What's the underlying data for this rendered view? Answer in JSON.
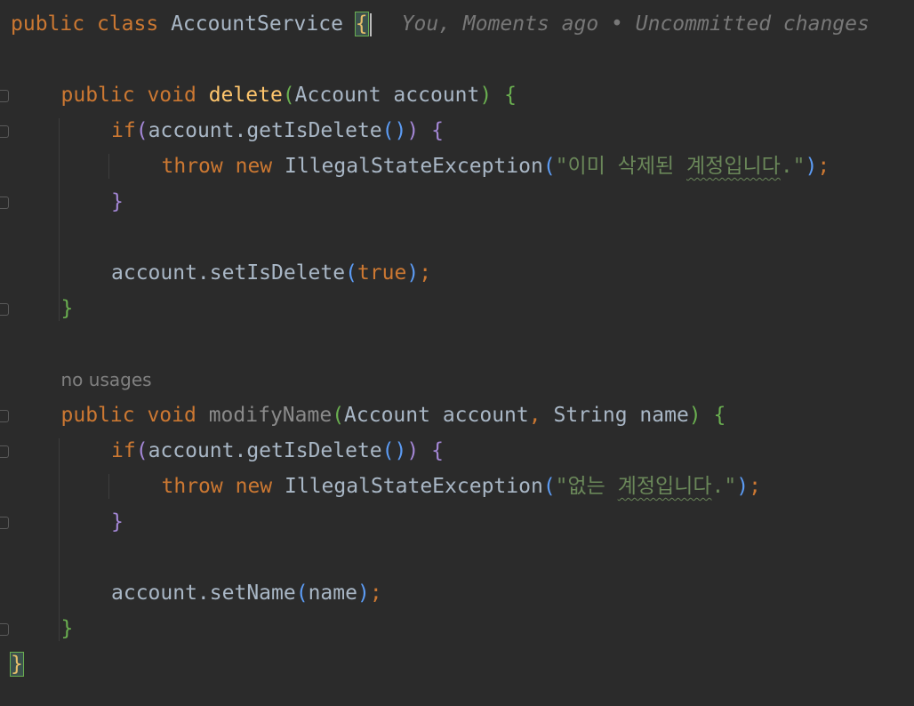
{
  "lines": [
    {
      "tokens": [
        {
          "t": "public",
          "c": "kw"
        },
        {
          "t": " "
        },
        {
          "t": "class",
          "c": "kw"
        },
        {
          "t": " "
        },
        {
          "t": "AccountService",
          "c": "cls"
        },
        {
          "t": " "
        },
        {
          "t": "{",
          "c": "brace-yellow brace-match"
        }
      ],
      "caret": true,
      "blame": "You, Moments ago • Uncommitted changes"
    },
    {
      "tokens": []
    },
    {
      "tokens": [
        {
          "t": "public",
          "c": "kw"
        },
        {
          "t": " "
        },
        {
          "t": "void",
          "c": "kw"
        },
        {
          "t": " "
        },
        {
          "t": "delete",
          "c": "fn"
        },
        {
          "t": "(",
          "c": "paren-green"
        },
        {
          "t": "Account account"
        },
        {
          "t": ")",
          "c": "paren-green"
        },
        {
          "t": " "
        },
        {
          "t": "{",
          "c": "brace-green"
        }
      ]
    },
    {
      "tokens": [
        {
          "t": "if",
          "c": "kw"
        },
        {
          "t": "(",
          "c": "paren-purple"
        },
        {
          "t": "account.getIsDelete"
        },
        {
          "t": "()",
          "c": "paren-blue"
        },
        {
          "t": ")",
          "c": "paren-purple"
        },
        {
          "t": " "
        },
        {
          "t": "{",
          "c": "paren-purple"
        }
      ]
    },
    {
      "tokens": [
        {
          "t": "throw",
          "c": "kw"
        },
        {
          "t": " "
        },
        {
          "t": "new",
          "c": "kw"
        },
        {
          "t": " "
        },
        {
          "t": "IllegalStateException"
        },
        {
          "t": "(",
          "c": "paren-blue"
        },
        {
          "t": "\"이미 삭제된 ",
          "c": "str"
        },
        {
          "t": "계정입니다",
          "c": "str str-typo"
        },
        {
          "t": ".\"",
          "c": "str"
        },
        {
          "t": ")",
          "c": "paren-blue"
        },
        {
          "t": ";",
          "c": "semi"
        }
      ]
    },
    {
      "tokens": [
        {
          "t": "}",
          "c": "paren-purple"
        }
      ]
    },
    {
      "tokens": []
    },
    {
      "tokens": [
        {
          "t": "account.setIsDelete"
        },
        {
          "t": "(",
          "c": "paren-blue"
        },
        {
          "t": "true",
          "c": "kw"
        },
        {
          "t": ")",
          "c": "paren-blue"
        },
        {
          "t": ";",
          "c": "semi"
        }
      ]
    },
    {
      "tokens": [
        {
          "t": "}",
          "c": "brace-green"
        }
      ]
    },
    {
      "tokens": []
    },
    {
      "hint": "no usages"
    },
    {
      "tokens": [
        {
          "t": "public",
          "c": "kw"
        },
        {
          "t": " "
        },
        {
          "t": "void",
          "c": "kw"
        },
        {
          "t": " "
        },
        {
          "t": "modifyName",
          "c": "fn-unused"
        },
        {
          "t": "(",
          "c": "paren-green"
        },
        {
          "t": "Account account"
        },
        {
          "t": ",",
          "c": "comma"
        },
        {
          "t": " String name"
        },
        {
          "t": ")",
          "c": "paren-green"
        },
        {
          "t": " "
        },
        {
          "t": "{",
          "c": "brace-green"
        }
      ]
    },
    {
      "tokens": [
        {
          "t": "if",
          "c": "kw"
        },
        {
          "t": "(",
          "c": "paren-purple"
        },
        {
          "t": "account.getIsDelete"
        },
        {
          "t": "()",
          "c": "paren-blue"
        },
        {
          "t": ")",
          "c": "paren-purple"
        },
        {
          "t": " "
        },
        {
          "t": "{",
          "c": "paren-purple"
        }
      ]
    },
    {
      "tokens": [
        {
          "t": "throw",
          "c": "kw"
        },
        {
          "t": " "
        },
        {
          "t": "new",
          "c": "kw"
        },
        {
          "t": " "
        },
        {
          "t": "IllegalStateException"
        },
        {
          "t": "(",
          "c": "paren-blue"
        },
        {
          "t": "\"없는 ",
          "c": "str"
        },
        {
          "t": "계정입니다",
          "c": "str str-typo"
        },
        {
          "t": ".\"",
          "c": "str"
        },
        {
          "t": ")",
          "c": "paren-blue"
        },
        {
          "t": ";",
          "c": "semi"
        }
      ]
    },
    {
      "tokens": [
        {
          "t": "}",
          "c": "paren-purple"
        }
      ]
    },
    {
      "tokens": []
    },
    {
      "tokens": [
        {
          "t": "account.setName"
        },
        {
          "t": "(",
          "c": "paren-blue"
        },
        {
          "t": "name"
        },
        {
          "t": ")",
          "c": "paren-blue"
        },
        {
          "t": ";",
          "c": "semi"
        }
      ]
    },
    {
      "tokens": [
        {
          "t": "}",
          "c": "brace-green"
        }
      ]
    },
    {
      "tokens": [
        {
          "t": "}",
          "c": "brace-yellow brace-match"
        }
      ]
    }
  ]
}
